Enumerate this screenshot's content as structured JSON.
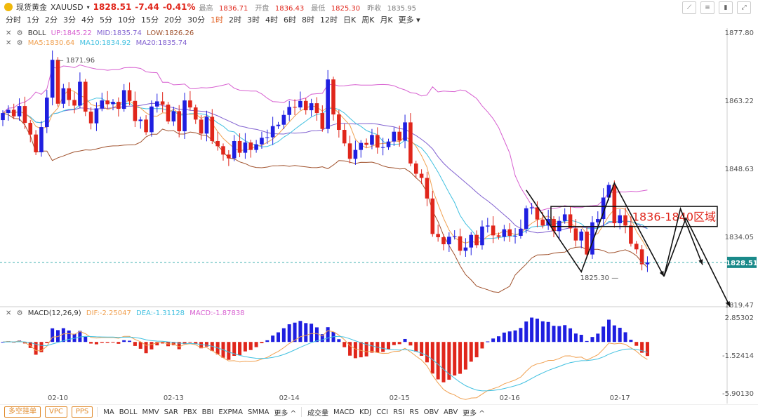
{
  "header": {
    "name": "现货黄金",
    "symbol": "XAUUSD",
    "price": "1828.51",
    "change": "-7.44",
    "change_pct": "-0.41%",
    "high_label": "最高",
    "high": "1836.71",
    "open_label": "开盘",
    "open": "1836.43",
    "low_label": "最低",
    "low": "1825.30",
    "prev_label": "昨收",
    "prev": "1835.95"
  },
  "periods": [
    "分时",
    "1分",
    "2分",
    "3分",
    "4分",
    "5分",
    "10分",
    "15分",
    "20分",
    "30分",
    "1时",
    "2时",
    "3时",
    "4时",
    "6时",
    "8时",
    "12时",
    "日K",
    "周K",
    "月K",
    "更多"
  ],
  "active_period": "1时",
  "legend": {
    "boll_name": "BOLL",
    "up": "UP:1845.22",
    "mid": "MID:1835.74",
    "low": "LOW:1826.26",
    "ma5": "MA5:1830.64",
    "ma10": "MA10:1834.92",
    "ma20": "MA20:1835.74",
    "macd_name": "MACD(12,26,9)",
    "dif": "DIF:-2.25047",
    "dea": "DEA:-1.31128",
    "macd": "MACD:-1.87838"
  },
  "bottom": {
    "buttons": [
      "多空挂单",
      "VPC",
      "PPS"
    ],
    "indicators1": [
      "MA",
      "BOLL",
      "MMV",
      "SAR",
      "PBX",
      "BBI",
      "EXPMA",
      "SMMA",
      "更多 ^"
    ],
    "indicators2": [
      "成交量",
      "MACD",
      "KDJ",
      "CCI",
      "RSI",
      "RS",
      "OBV",
      "ABV",
      "更多 ^"
    ]
  },
  "colors": {
    "up": "#1f1fe0",
    "down": "#e0261b",
    "upper": "#d75fd0",
    "lower": "#a0522d",
    "ma5": "#f0a050",
    "ma10": "#40c0e0",
    "ma20": "#8060d0"
  },
  "chart_data": [
    {
      "type": "candlestick",
      "interval": "1时",
      "x_ticks": [
        "02-10",
        "02-13",
        "02-14",
        "02-15",
        "02-16",
        "02-17"
      ],
      "y_ticks": [
        1877.8,
        1863.22,
        1848.63,
        1834.05,
        1819.47
      ],
      "ylim": [
        1819.47,
        1877.8
      ],
      "last_price": 1828.51,
      "annotations": [
        "1871.96",
        "1825.30",
        "1836-1840区域"
      ],
      "close": [
        1860.5,
        1861.2,
        1859.8,
        1862.0,
        1858.4,
        1855.9,
        1852.1,
        1857.5,
        1863.8,
        1871.9,
        1862.5,
        1865.8,
        1863.3,
        1862.1,
        1867.2,
        1860.8,
        1858.3,
        1861.5,
        1863.2,
        1862.4,
        1862.9,
        1861.4,
        1865.4,
        1863.1,
        1858.8,
        1859.1,
        1856.4,
        1861.9,
        1863.0,
        1862.3,
        1858.7,
        1860.9,
        1856.6,
        1863.2,
        1861.7,
        1859.1,
        1856.1,
        1859.7,
        1854.5,
        1853.4,
        1851.6,
        1850.8,
        1854.5,
        1852.0,
        1854.2,
        1852.6,
        1853.8,
        1855.2,
        1855.3,
        1857.7,
        1858.0,
        1860.1,
        1861.8,
        1861.7,
        1863.1,
        1861.1,
        1862.6,
        1860.5,
        1857.1,
        1867.7,
        1860.2,
        1856.9,
        1854.0,
        1850.7,
        1852.6,
        1854.1,
        1853.7,
        1855.8,
        1853.1,
        1853.2,
        1854.4,
        1856.5,
        1854.6,
        1858.5,
        1849.7,
        1847.5,
        1846.6,
        1842.2,
        1834.6,
        1833.9,
        1832.4,
        1834.0,
        1834.1,
        1831.0,
        1831.7,
        1834.4,
        1832.2,
        1836.2,
        1836.4,
        1834.3,
        1834.0,
        1835.6,
        1834.2,
        1834.2,
        1835.7,
        1840.1,
        1840.3,
        1837.7,
        1836.4,
        1837.8,
        1835.2,
        1837.4,
        1838.8,
        1835.8,
        1833.2,
        1835.1,
        1830.2,
        1837.1,
        1837.8,
        1842.4,
        1845.1,
        1836.9,
        1838.6,
        1836.4,
        1832.5,
        1831.3,
        1828.1,
        1828.5
      ],
      "bands": {
        "upper": 1845.22,
        "mid": 1835.74,
        "lower": 1826.26
      },
      "ma": {
        "ma5": 1830.64,
        "ma10": 1834.92,
        "ma20": 1835.74
      }
    },
    {
      "type": "bar",
      "name": "MACD(12,26,9)",
      "y_ticks": [
        2.85302,
        -1.52414,
        -5.9013
      ],
      "ylim": [
        -5.9013,
        2.85302
      ],
      "dif": -2.25047,
      "dea": -1.31128,
      "macd": -1.87838
    }
  ]
}
